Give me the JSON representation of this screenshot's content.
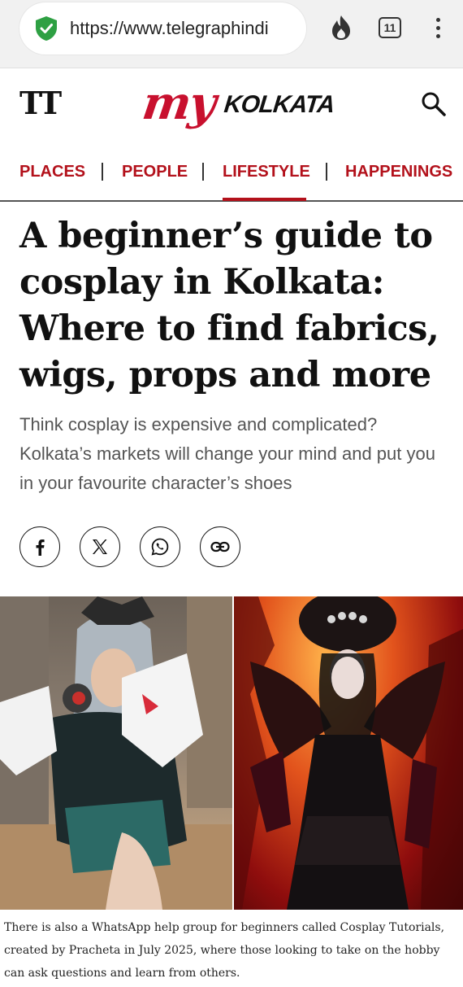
{
  "browser": {
    "url": "https://www.telegraphindi",
    "tab_count": "11"
  },
  "site": {
    "tt_logo": "TT",
    "brand_my": "my",
    "brand_kolkata": "KOLKATA"
  },
  "nav": {
    "items": [
      {
        "label": "PLACES"
      },
      {
        "label": "PEOPLE"
      },
      {
        "label": "LIFESTYLE"
      },
      {
        "label": "HAPPENINGS"
      }
    ],
    "active": "LIFESTYLE"
  },
  "article": {
    "headline": "A beginner’s guide to cosplay in Kolkata: Where to find fabrics, wigs, props and more",
    "dek": "Think cosplay is expensive and complicated? Kolkata’s markets will change your mind and put you in your favourite character’s shoes",
    "share_icons": [
      "facebook-icon",
      "x-icon",
      "whatsapp-icon",
      "link-icon"
    ],
    "caption": "There is also a WhatsApp help group for beginners called Cosplay Tutorials, created by Pracheta in July 2025, where those looking to take on the hobby can ask questions and learn from others."
  },
  "colors": {
    "brand_red": "#c8102e",
    "nav_red": "#b3111b"
  }
}
